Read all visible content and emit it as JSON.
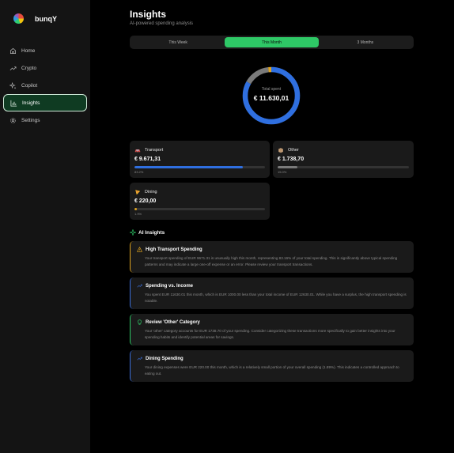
{
  "brand": {
    "name": "bunqY"
  },
  "sidebar": {
    "items": [
      {
        "label": "Home",
        "icon": "home-icon",
        "active": false
      },
      {
        "label": "Crypto",
        "icon": "trend-icon",
        "active": false
      },
      {
        "label": "Copilot",
        "icon": "sparkle-icon",
        "active": false
      },
      {
        "label": "Insights",
        "icon": "chart-icon",
        "active": true
      },
      {
        "label": "Settings",
        "icon": "gear-icon",
        "active": false
      }
    ]
  },
  "header": {
    "title": "Insights",
    "subtitle": "AI-powered spending analysis"
  },
  "tabs": [
    {
      "label": "This Week",
      "active": false
    },
    {
      "label": "This Month",
      "active": true
    },
    {
      "label": "3 Months",
      "active": false
    }
  ],
  "summary": {
    "label": "Total spent",
    "value": "€ 11.630,01"
  },
  "categories": [
    {
      "name": "Transport",
      "amount": "€ 9.671,31",
      "percent_label": "83.2%",
      "fraction": 0.832,
      "color": "#2f6fe0",
      "icon": "car-icon"
    },
    {
      "name": "Other",
      "amount": "€ 1.738,70",
      "percent_label": "15.0%",
      "fraction": 0.15,
      "color": "#7a7a7a",
      "icon": "box-icon"
    },
    {
      "name": "Dining",
      "amount": "€ 220,00",
      "percent_label": "1.9%",
      "fraction": 0.019,
      "color": "#e0a41f",
      "icon": "pizza-icon"
    }
  ],
  "ai_insights": {
    "title": "AI Insights",
    "items": [
      {
        "title": "High Transport Spending",
        "icon": "warning-icon",
        "accent": "#e0a41f",
        "text": "Your transport spending of EUR 9671.31 is unusually high this month, representing 83.16% of your total spending. This is significantly above typical spending patterns and may indicate a large one-off expense or an error. Please review your transport transactions."
      },
      {
        "title": "Spending vs. Income",
        "icon": "trend-icon",
        "accent": "#3b6fd9",
        "text": "You spent EUR 11630.01 this month, which is EUR 1000.00 less than your total income of EUR 12630.01. While you have a surplus, the high transport spending is notable."
      },
      {
        "title": "Review 'Other' Category",
        "icon": "lightbulb-icon",
        "accent": "#2ec866",
        "text": "Your 'other' category accounts for EUR 1738.70 of your spending. Consider categorizing these transactions more specifically to gain better insights into your spending habits and identify potential areas for savings."
      },
      {
        "title": "Dining Spending",
        "icon": "trend-icon",
        "accent": "#3b6fd9",
        "text": "Your dining expenses were EUR 220.00 this month, which is a relatively small portion of your overall spending (1.89%). This indicates a controlled approach to eating out."
      }
    ]
  }
}
